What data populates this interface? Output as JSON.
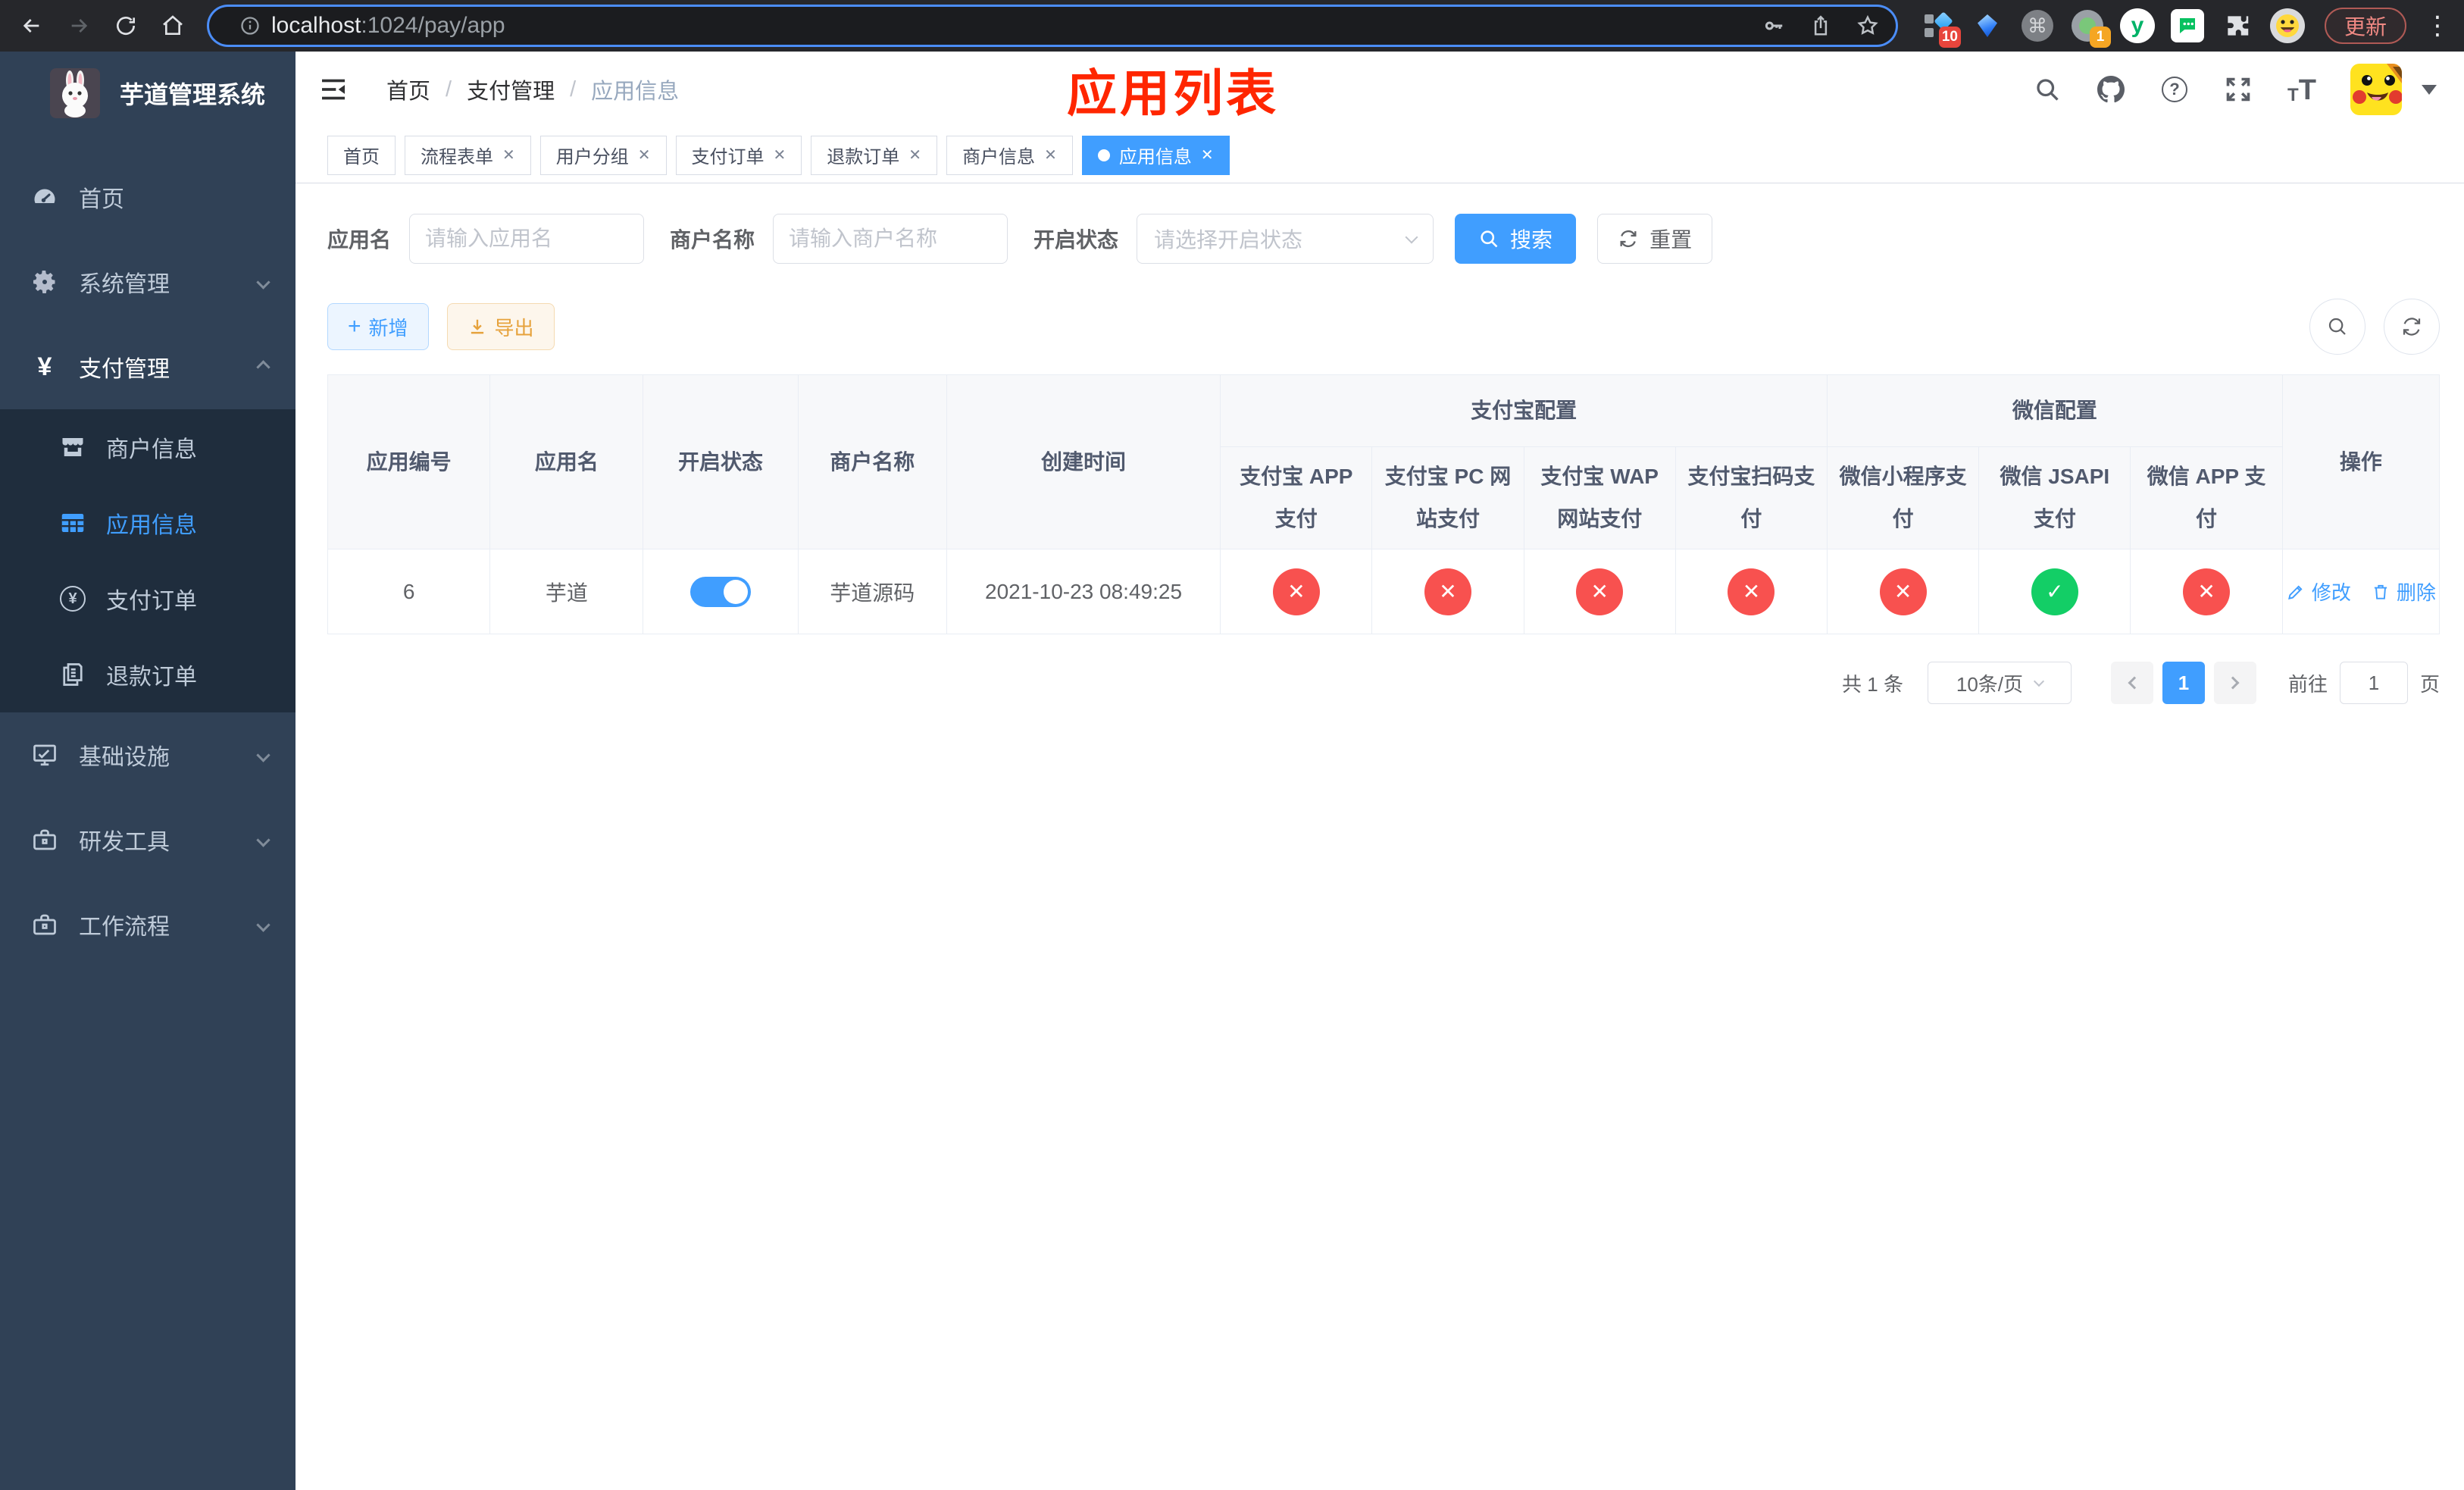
{
  "browser": {
    "url_host": "localhost",
    "url_path": ":1024/pay/app",
    "ext_badge_10": "10",
    "ext_badge_1": "1",
    "update_button": "更新"
  },
  "sidebar": {
    "title": "芋道管理系统",
    "menu": [
      {
        "label": "首页"
      },
      {
        "label": "系统管理"
      },
      {
        "label": "支付管理"
      },
      {
        "label": "基础设施"
      },
      {
        "label": "研发工具"
      },
      {
        "label": "工作流程"
      }
    ],
    "submenu": [
      {
        "label": "商户信息"
      },
      {
        "label": "应用信息"
      },
      {
        "label": "支付订单"
      },
      {
        "label": "退款订单"
      }
    ]
  },
  "navbar": {
    "breadcrumb": [
      "首页",
      "支付管理",
      "应用信息"
    ]
  },
  "overlay_title": "应用列表",
  "tabs": [
    {
      "label": "首页"
    },
    {
      "label": "流程表单"
    },
    {
      "label": "用户分组"
    },
    {
      "label": "支付订单"
    },
    {
      "label": "退款订单"
    },
    {
      "label": "商户信息"
    },
    {
      "label": "应用信息"
    }
  ],
  "filters": {
    "app_name_label": "应用名",
    "app_name_placeholder": "请输入应用名",
    "merchant_label": "商户名称",
    "merchant_placeholder": "请输入商户名称",
    "status_label": "开启状态",
    "status_placeholder": "请选择开启状态",
    "search_button": "搜索",
    "reset_button": "重置"
  },
  "toolbar": {
    "add_button": "新增",
    "export_button": "导出"
  },
  "table": {
    "columns": {
      "app_id": "应用编号",
      "app_name": "应用名",
      "status": "开启状态",
      "merchant": "商户名称",
      "create_time": "创建时间",
      "alipay_group": "支付宝配置",
      "wechat_group": "微信配置",
      "actions": "操作",
      "alipay_app": "支付宝 APP 支付",
      "alipay_pc": "支付宝 PC 网站支付",
      "alipay_wap": "支付宝 WAP 网站支付",
      "alipay_qr": "支付宝扫码支付",
      "wx_lite": "微信小程序支付",
      "wx_jsapi": "微信 JSAPI 支付",
      "wx_app": "微信 APP 支付"
    },
    "symbols": {
      "pass": "✓",
      "fail": "✕"
    },
    "rows": [
      {
        "app_id": "6",
        "app_name": "芋道",
        "status_on": true,
        "merchant": "芋道源码",
        "create_time": "2021-10-23 08:49:25",
        "channels": [
          false,
          false,
          false,
          false,
          false,
          true,
          false
        ],
        "edit_label": "修改",
        "delete_label": "删除"
      }
    ]
  },
  "pagination": {
    "total": "共 1 条",
    "page_size": "10条/页",
    "current_page": "1",
    "goto_label": "前往",
    "goto_value": "1",
    "goto_suffix": "页"
  },
  "colors": {
    "accent": "#409eff",
    "success": "#13ce66",
    "danger": "#f8514f",
    "title_red": "#ff2600",
    "sidebar_bg": "#304156",
    "submenu_bg": "#1f2d3d"
  }
}
